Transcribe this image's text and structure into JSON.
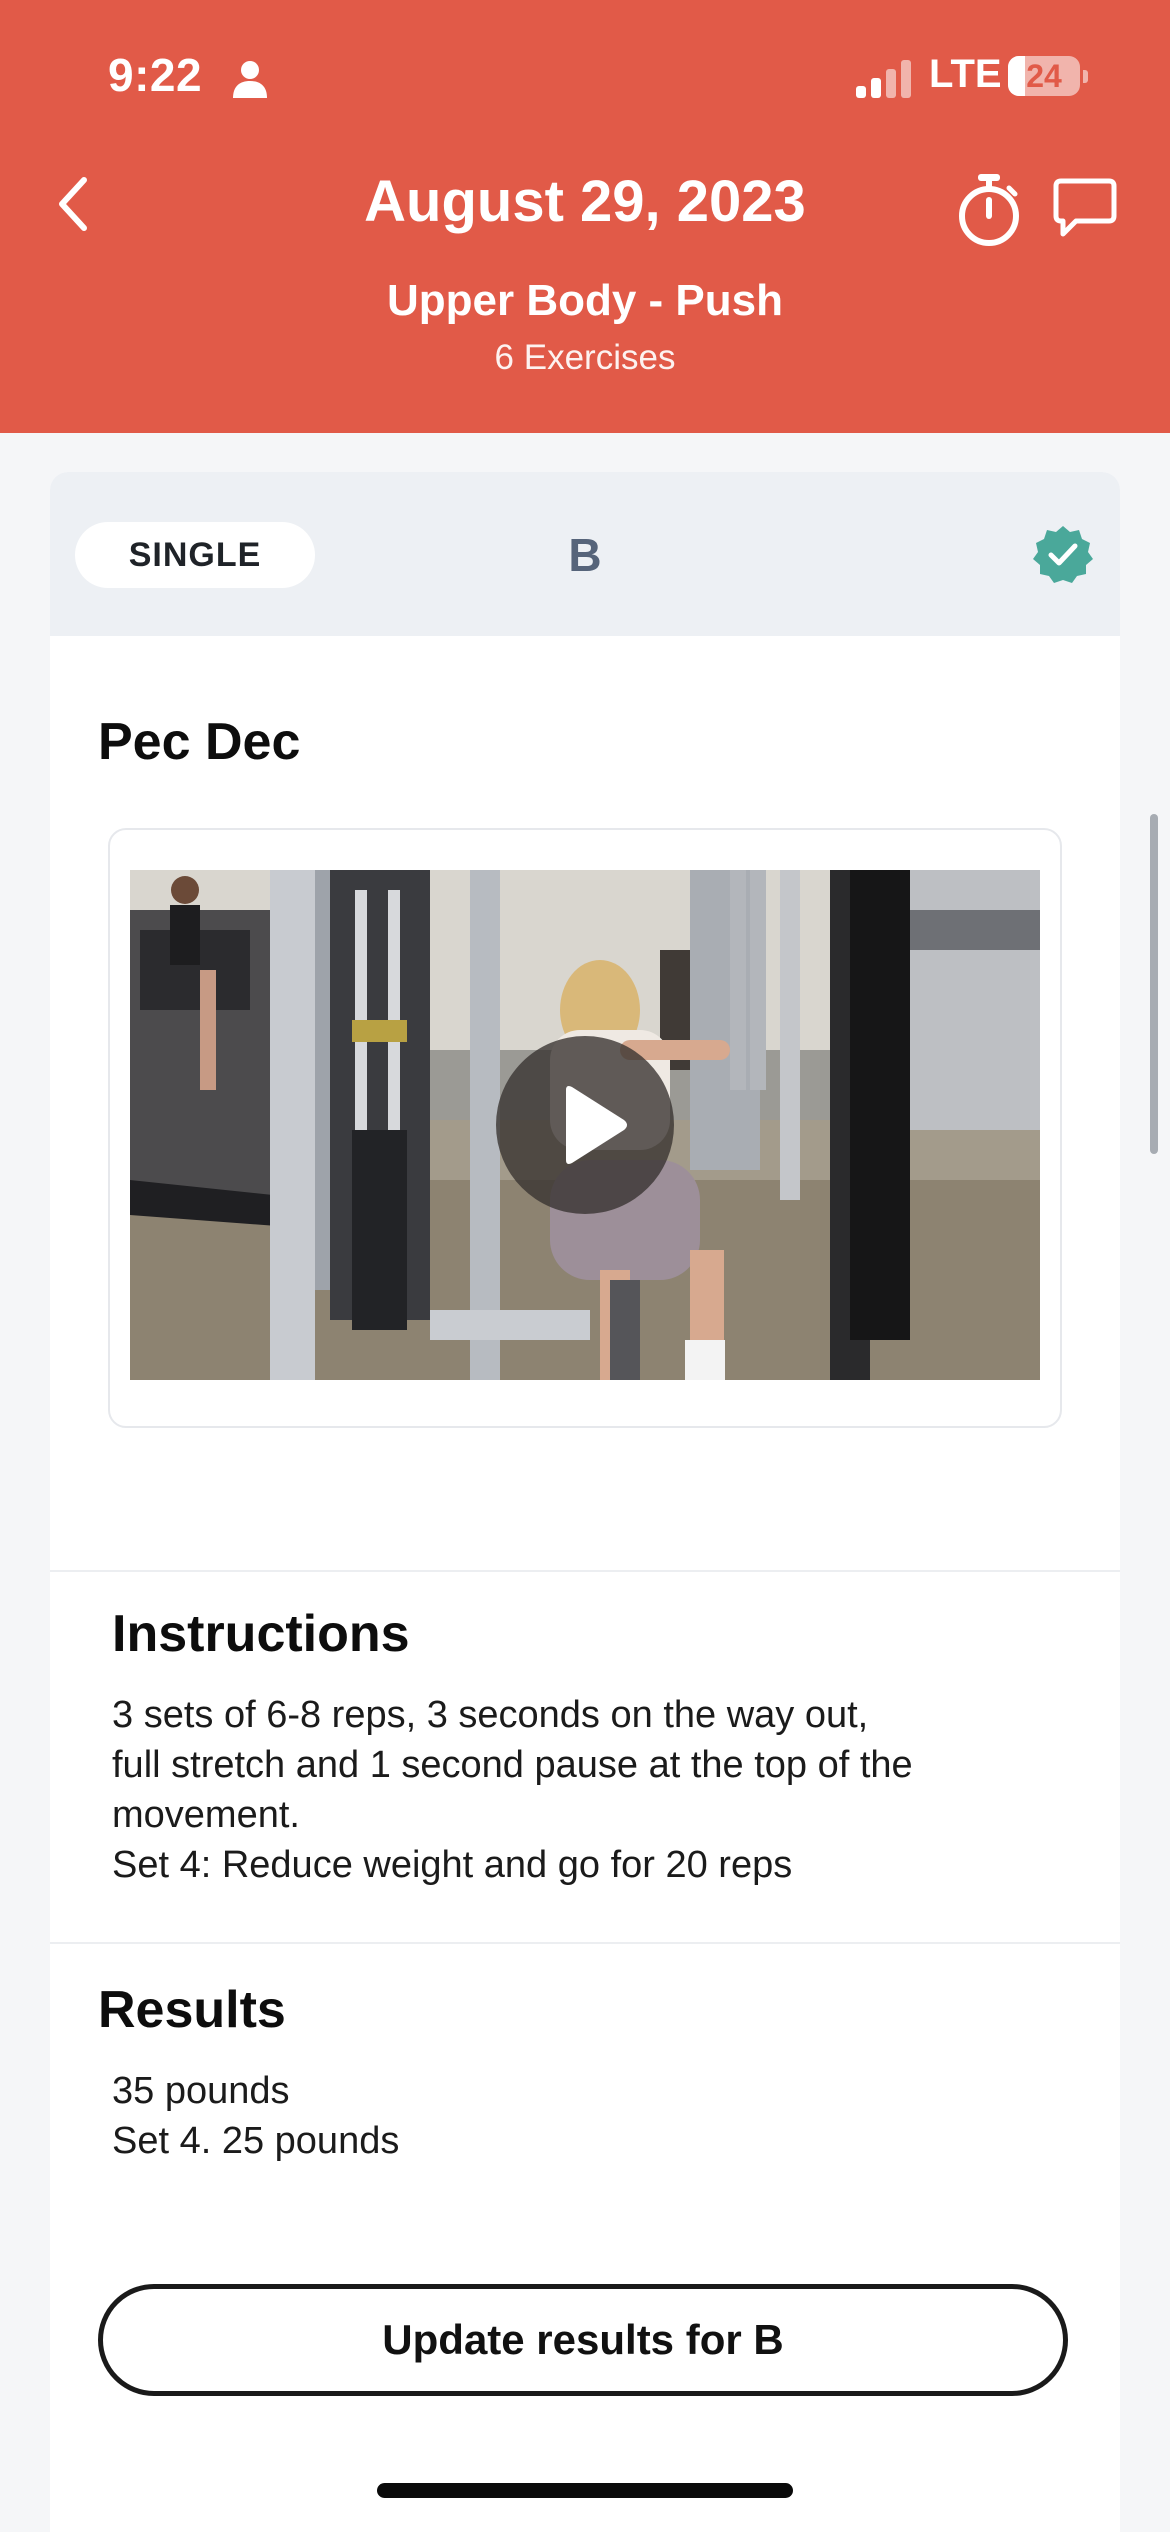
{
  "status_bar": {
    "time": "9:22",
    "network": "LTE",
    "battery_level": "24",
    "battery_fraction": 0.24
  },
  "header": {
    "title": "August 29, 2023",
    "workout_name": "Upper Body - Push",
    "exercise_count": "6 Exercises",
    "icons": [
      "chevron-left-icon",
      "stopwatch-icon",
      "chat-icon"
    ],
    "background_color": "#e15a48"
  },
  "exercise_block": {
    "type": "SINGLE",
    "group": "B",
    "completed": true,
    "check_color": "#4aa89a"
  },
  "exercise": {
    "name": "Pec Dec"
  },
  "instructions": {
    "title": "Instructions",
    "lines": [
      "3 sets of 6-8 reps, 3 seconds on the way out,",
      "full stretch and 1 second pause at the top of the",
      "movement.",
      "Set 4: Reduce weight and go for 20 reps"
    ]
  },
  "results": {
    "title": "Results",
    "lines": [
      "35 pounds",
      "Set 4. 25 pounds"
    ]
  },
  "actions": {
    "update_button": "Update results for B"
  }
}
